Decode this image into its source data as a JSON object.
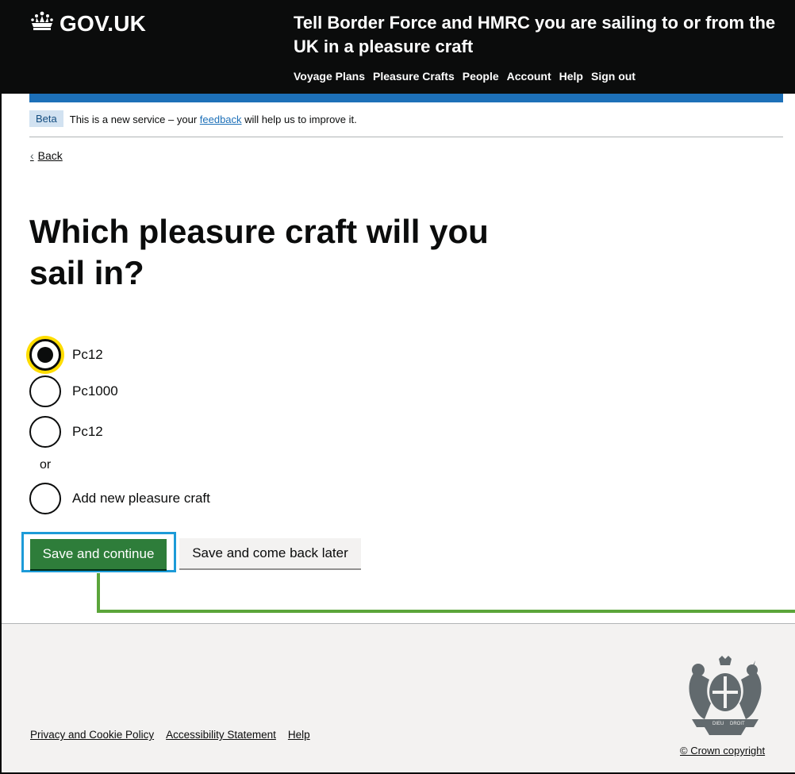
{
  "header": {
    "logo_text": "GOV.UK",
    "service_name": "Tell Border Force and HMRC you are sailing to or from the UK in a pleasure craft",
    "nav": [
      "Voyage Plans",
      "Pleasure Crafts",
      "People",
      "Account",
      "Help",
      "Sign out"
    ]
  },
  "phase_banner": {
    "tag": "Beta",
    "text_before": "This is a new service – your ",
    "link": "feedback",
    "text_after": " will help us to improve it."
  },
  "back_link": "Back",
  "page_title": "Which pleasure craft will you sail in?",
  "radios": [
    {
      "label": "Pc12",
      "checked": true
    },
    {
      "label": "Pc1000",
      "checked": false
    },
    {
      "label": "Pc12",
      "checked": false
    }
  ],
  "or_text": "or",
  "add_new_radio": {
    "label": "Add new pleasure craft",
    "checked": false
  },
  "buttons": {
    "primary": "Save and continue",
    "secondary": "Save and come back later"
  },
  "footer": {
    "links": [
      "Privacy and Cookie Policy",
      "Accessibility Statement",
      "Help"
    ],
    "copyright": "© Crown copyright"
  },
  "colors": {
    "header_bg": "#0b0c0c",
    "blue_bar": "#1d70b8",
    "primary_button": "#2e7d3a",
    "focus_yellow": "#ffdd00",
    "annotation_blue": "#1d9bd8",
    "annotation_green": "#5ba53a"
  }
}
